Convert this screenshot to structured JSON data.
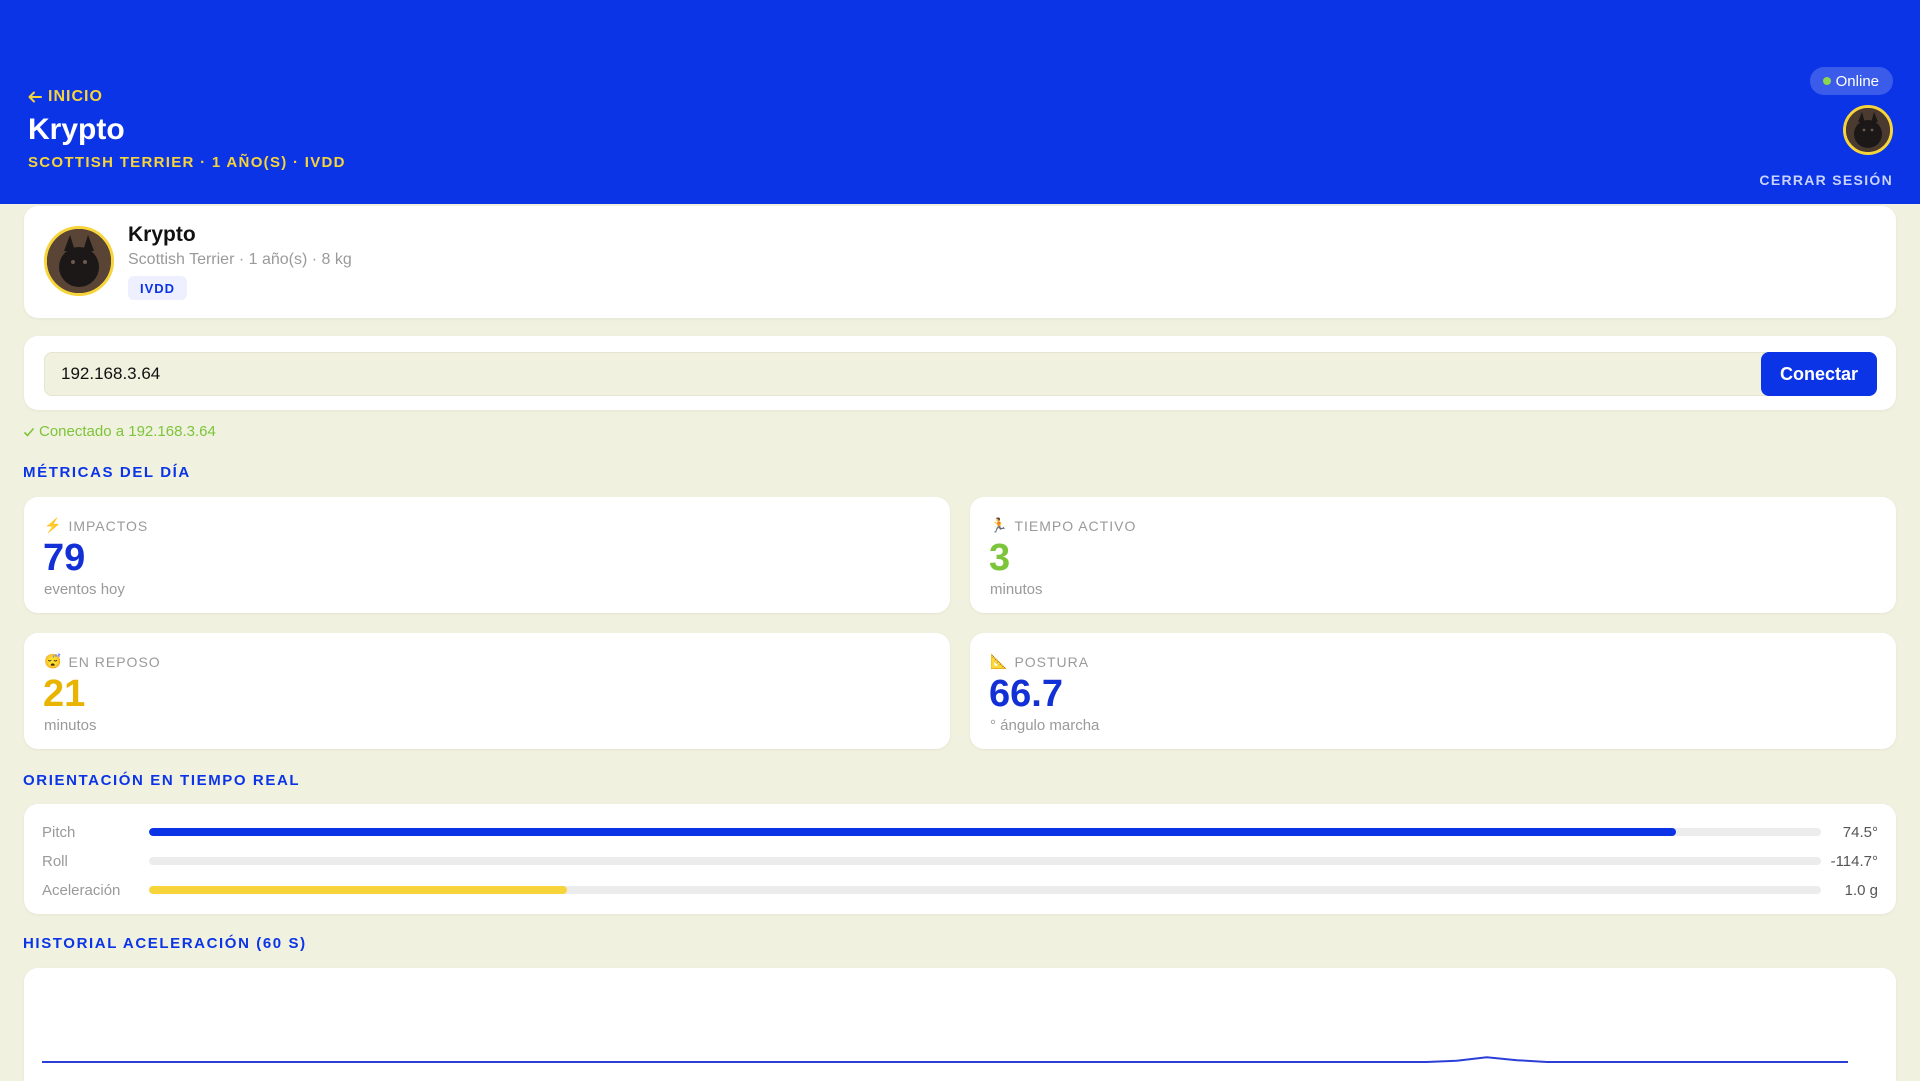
{
  "header": {
    "back_label": "INICIO",
    "pet_name": "Krypto",
    "subtitle": "SCOTTISH TERRIER · 1 AÑO(S) · IVDD",
    "status": "Online",
    "logout_label": "CERRAR SESIÓN"
  },
  "profile": {
    "name": "Krypto",
    "details": "Scottish Terrier · 1 año(s) · 8 kg",
    "tag": "IVDD"
  },
  "connection": {
    "ip_value": "192.168.3.64",
    "button_label": "Conectar",
    "status_text": "Conectado a 192.168.3.64"
  },
  "metrics": {
    "section_title": "MÉTRICAS DEL DÍA",
    "items": [
      {
        "icon": "lightning-icon",
        "glyph": "⚡",
        "label": "IMPACTOS",
        "value": "79",
        "unit": "eventos hoy",
        "color": "#1230d6"
      },
      {
        "icon": "runner-icon",
        "glyph": "🏃",
        "label": "TIEMPO ACTIVO",
        "value": "3",
        "unit": "minutos",
        "color": "#7cc43a"
      },
      {
        "icon": "sleeping-face-icon",
        "glyph": "😴",
        "label": "EN REPOSO",
        "value": "21",
        "unit": "minutos",
        "color": "#e8b400"
      },
      {
        "icon": "triangle-ruler-icon",
        "glyph": "📐",
        "label": "POSTURA",
        "value": "66.7",
        "unit": "° ángulo marcha",
        "color": "#1230d6"
      }
    ]
  },
  "orientation": {
    "section_title": "ORIENTACIÓN EN TIEMPO REAL",
    "rows": [
      {
        "label": "Pitch",
        "value": "74.5°",
        "fill_fraction": 0.913,
        "color": "#0b34e6"
      },
      {
        "label": "Roll",
        "value": "-114.7°",
        "fill_fraction": 0.0,
        "color": "#0b34e6"
      },
      {
        "label": "Aceleración",
        "value": "1.0 g",
        "fill_fraction": 0.25,
        "color": "#f6d43a"
      }
    ]
  },
  "history": {
    "section_title": "HISTORIAL ACELERACIÓN (60 S)",
    "line_color": "#2b3fd8",
    "chart_data": {
      "type": "line",
      "title": "",
      "xlabel": "",
      "ylabel": "",
      "x": [
        0,
        2,
        4,
        6,
        8,
        10,
        12,
        14,
        16,
        18,
        20,
        22,
        24,
        26,
        28,
        30,
        32,
        34,
        36,
        38,
        40,
        42,
        44,
        46,
        47,
        48,
        49,
        50,
        52,
        54,
        56,
        58,
        60
      ],
      "series": [
        {
          "values": [
            1.0,
            1.0,
            1.0,
            1.0,
            1.0,
            1.0,
            1.0,
            1.0,
            1.0,
            1.0,
            1.0,
            1.0,
            1.0,
            1.0,
            1.0,
            1.0,
            1.0,
            1.0,
            1.0,
            1.0,
            1.0,
            1.0,
            1.0,
            1.0,
            1.02,
            1.08,
            1.03,
            1.0,
            1.0,
            1.0,
            1.0,
            1.0,
            1.0
          ]
        }
      ],
      "ylim": [
        0,
        4
      ]
    }
  }
}
